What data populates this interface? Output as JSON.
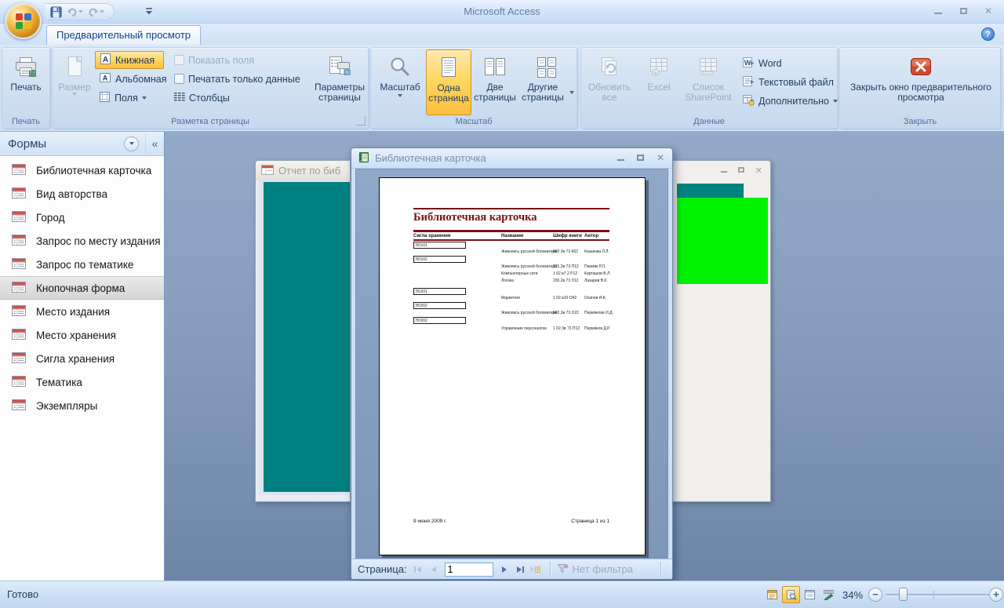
{
  "titlebar": {
    "app_title": "Microsoft Access"
  },
  "tabs": {
    "active": "Предварительный просмотр"
  },
  "ribbon": {
    "print_group": {
      "label": "Печать",
      "print": "Печать"
    },
    "layout_group": {
      "label": "Разметка страницы",
      "size": "Размер",
      "portrait": "Книжная",
      "landscape": "Альбомная",
      "margins": "Поля",
      "show_margins": "Показать поля",
      "data_only": "Печатать только данные",
      "columns": "Столбцы",
      "page_setup": "Параметры страницы"
    },
    "zoom_group": {
      "label": "Масштаб",
      "zoom": "Масштаб",
      "one_page": "Одна страница",
      "two_pages": "Две страницы",
      "more_pages": "Другие страницы"
    },
    "data_group": {
      "label": "Данные",
      "refresh_all": "Обновить все",
      "excel": "Excel",
      "sharepoint": "Список SharePoint",
      "word": "Word",
      "text_file": "Текстовый файл",
      "more": "Дополнительно"
    },
    "close_group": {
      "label": "Закрыть",
      "close": "Закрыть окно предварительного просмотра"
    }
  },
  "sidebar": {
    "title": "Формы",
    "items": [
      "Библиотечная карточка",
      "Вид авторства",
      "Город",
      "Запрос по месту издания",
      "Запрос по тематике",
      "Кнопочная форма",
      "Место издания",
      "Место хранения",
      "Сигла хранения",
      "Тематика",
      "Экземпляры"
    ],
    "selected_item": "Кнопочная форма"
  },
  "back_window": {
    "title": "Отчет по биб"
  },
  "preview": {
    "title": "Библиотечная карточка",
    "nav": {
      "page_label": "Страница:",
      "page_value": "1",
      "filter_label": "Нет фильтра"
    }
  },
  "report": {
    "title": "Библиотечная карточка",
    "columns": [
      "Сигла хранения",
      "Название",
      "Шифр книги",
      "Автор"
    ],
    "groups": [
      {
        "sigla": "ЭО101",
        "rows": [
          {
            "name": "Живопись русской богоматери",
            "code": "602.3в 73 К62",
            "author": "Казакова Л.Л."
          }
        ]
      },
      {
        "sigla": "ЭО102",
        "rows": [
          {
            "name": "Живопись русской богоматери",
            "code": "231.2в 73 П12",
            "author": "Пермяк Р.Л."
          },
          {
            "name": "Компьютерные сети",
            "code": "1 02 в7.2 Р12",
            "author": "Карташов В.Л."
          },
          {
            "name": "Логика",
            "code": "230.2в 73 Л12",
            "author": "Лазарев В.К."
          }
        ]
      },
      {
        "sigla": "ЭО201",
        "rows": [
          {
            "name": "Маркетинг",
            "code": "1 02 в10 О42",
            "author": "Осипов И.К."
          }
        ]
      },
      {
        "sigla": "ЭО202",
        "rows": [
          {
            "name": "Живопись русской богоматери",
            "code": "602.3в 73 О22",
            "author": "Пермякова И.Д."
          }
        ]
      },
      {
        "sigla": "ЭО302",
        "rows": [
          {
            "name": "Управление персоналом",
            "code": "1 02.3в 73 П12",
            "author": "Пермяков Д.Р."
          }
        ]
      }
    ],
    "footer_date": "9 июня 2009 г.",
    "footer_page": "Страница 1 из 1"
  },
  "statusbar": {
    "ready": "Готово",
    "zoom_percent": "34%"
  },
  "icons": {
    "office_button": "office-orb-icon",
    "save": "save-icon",
    "undo": "undo-icon",
    "redo": "redo-icon",
    "printer": "printer-icon",
    "magnifier": "zoom-icon",
    "close_preview": "red-x-icon",
    "form": "form-icon",
    "report_window": "report-icon",
    "filter": "filter-funnel-icon",
    "help": "help-icon"
  },
  "colors": {
    "accent_orange": "#FFD761",
    "maroon": "#7A1212",
    "teal": "#008080",
    "bright_green": "#00F200",
    "close_red": "#CF4A2E",
    "tab_text": "#15428B"
  }
}
